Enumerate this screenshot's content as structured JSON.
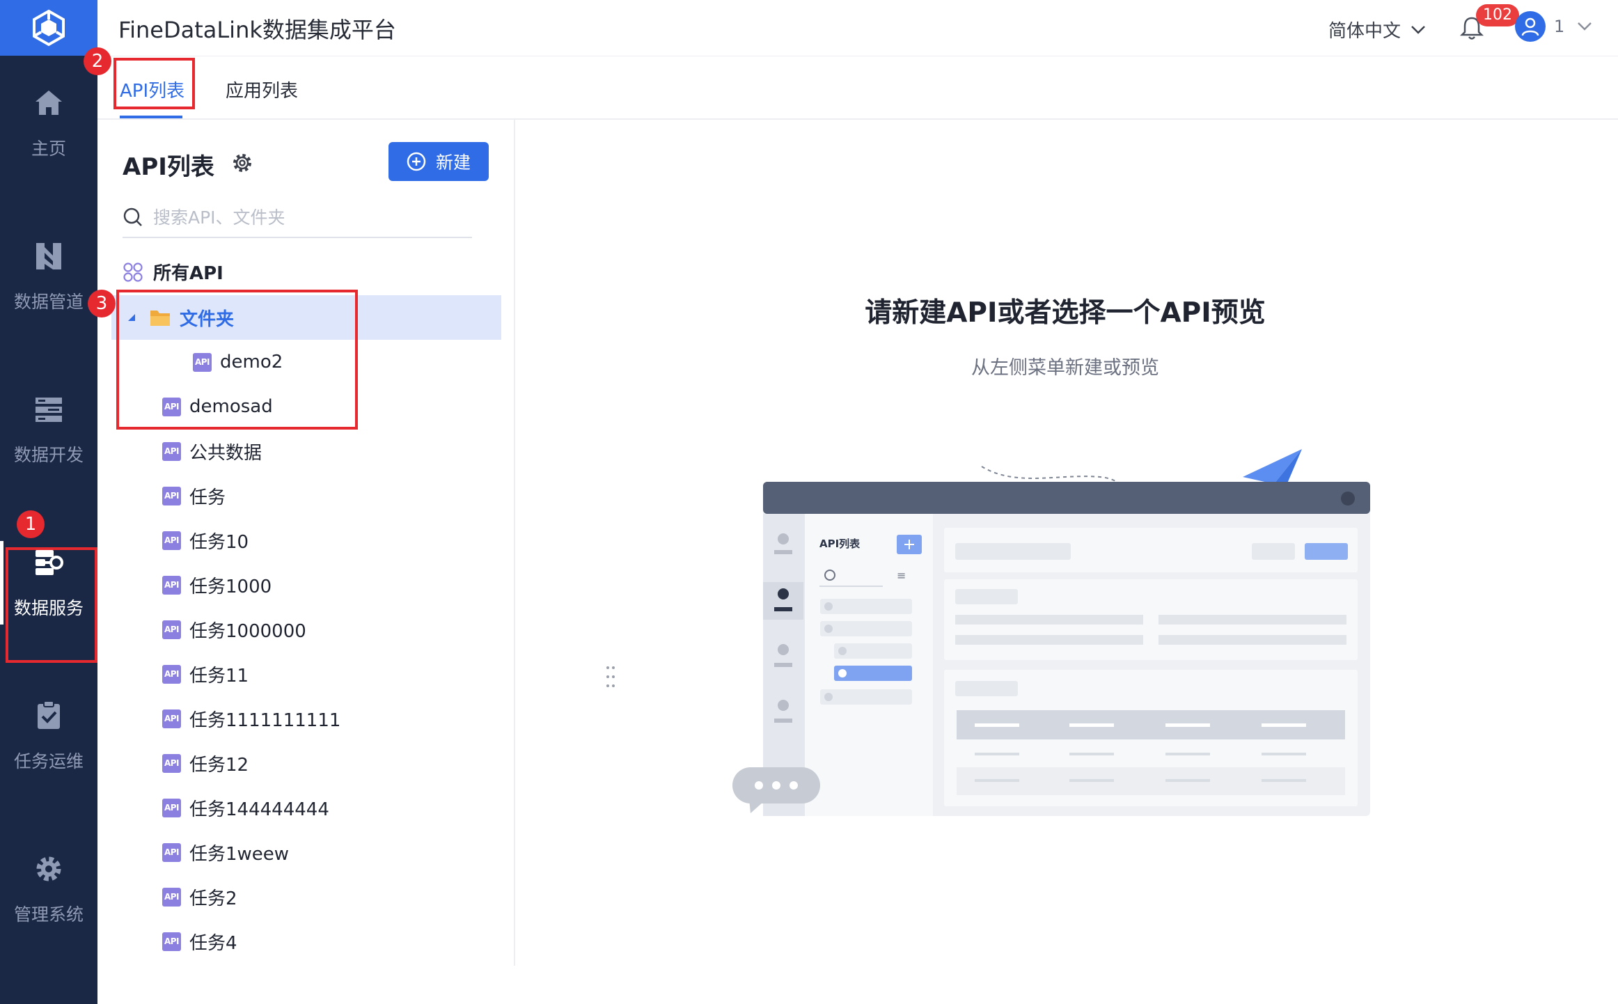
{
  "header": {
    "app_title": "FineDataLink数据集成平台",
    "language": "简体中文",
    "notification_count": "102",
    "user_name": "1"
  },
  "nav": {
    "items": [
      {
        "label": "主页",
        "icon": "home-icon"
      },
      {
        "label": "数据管道",
        "icon": "pipeline-icon"
      },
      {
        "label": "数据开发",
        "icon": "dev-icon"
      },
      {
        "label": "数据服务",
        "icon": "service-icon",
        "active": true
      },
      {
        "label": "任务运维",
        "icon": "clipboard-check-icon"
      },
      {
        "label": "管理系统",
        "icon": "gear-icon"
      }
    ]
  },
  "tabs": [
    {
      "label": "API列表",
      "active": true
    },
    {
      "label": "应用列表",
      "active": false
    }
  ],
  "panel": {
    "title": "API列表",
    "new_button": "新建",
    "search_placeholder": "搜索API、文件夹",
    "all_api_label": "所有API",
    "api_tag": "API",
    "folder": {
      "label": "文件夹",
      "children": [
        "demo2"
      ]
    },
    "apis": [
      "demosad",
      "公共数据",
      "任务",
      "任务10",
      "任务1000",
      "任务1000000",
      "任务11",
      "任务1111111111",
      "任务12",
      "任务144444444",
      "任务1weew",
      "任务2",
      "任务4"
    ]
  },
  "annotations": [
    "1",
    "2",
    "3"
  ],
  "empty_state": {
    "title": "请新建API或者选择一个API预览",
    "subtitle": "从左侧菜单新建或预览"
  },
  "illustration": {
    "panel_title": "API列表"
  },
  "colors": {
    "nav_bg": "#1b2845",
    "brand": "#2f6ce6",
    "annotation": "#e5292f",
    "selected_row": "#dde6fb",
    "api_tag": "#8b7fe0"
  }
}
